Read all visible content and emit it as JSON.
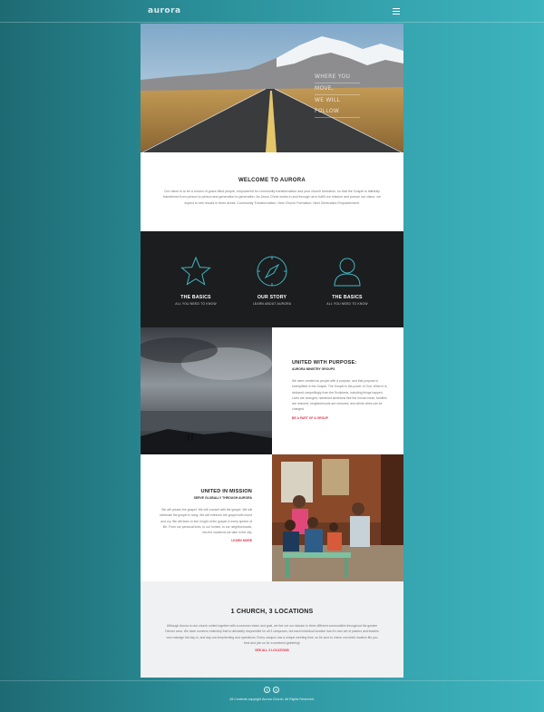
{
  "header": {
    "logo_text": "aurora",
    "menu_icon": "hamburger-icon"
  },
  "hero": {
    "caption_lines": [
      "WHERE YOU",
      "MOVE,",
      "WE WILL FOLLOW"
    ]
  },
  "welcome": {
    "title": "WELCOME TO AURORA",
    "body": "Our vision is to be a church of grace-filled people, empowered for community transformation and your church formation, so that the Gospel is faithfully transferred from person to person and generation to generation. As Jesus Christ works in and through us to fulfill our mission and pursue our vision, we expect to see results in three areas: Community Transformation, New Church Formation, Next Generation Empowerment."
  },
  "features": [
    {
      "icon": "star-icon",
      "title": "THE BASICS",
      "subtitle": "ALL YOU NEED TO KNOW"
    },
    {
      "icon": "compass-icon",
      "title": "OUR STORY",
      "subtitle": "LEARN ABOUT AURORA"
    },
    {
      "icon": "user-icon",
      "title": "THE BASICS",
      "subtitle": "ALL YOU NEED TO KNOW"
    }
  ],
  "purpose": {
    "title": "UNITED WITH PURPOSE:",
    "subtitle": "AURORA MINISTRY GROUPS",
    "body": "We were created as people with a purpose, and that purpose is exemplified in the Gospel. The Gospel is the power of God. When it is declared compellingly from the Scriptures, including things happen. Lives are changed, hardened skeletons flee the human heart, families are restored, neighborhoods are renewed, and whole cities can be changed.",
    "link": "BE A PART OF A GROUP"
  },
  "mission": {
    "title": "UNITED IN MISSION",
    "subtitle": "SERVE GLOBALLY THROUGH AURORA",
    "body": "We will preach the gospel. We will counsel with the gospel. We will celebrate the gospel in song. We will entrench the gospel with found and cry. We will learn to live in light of the gospel in every sphere of life. From our personal lives, to our homes, to our neighborhoods, into the vocations we take in the city.",
    "link": "LEARN MORE"
  },
  "locations": {
    "title": "1 CHURCH, 3 LOCATIONS",
    "body": "Although Aurora is one church united together with a common vision and goal, we live out our mission in three different communities throughout the greater Denver area. We have common eldership that is ultimately responsible for all 3 campuses, but each individual location has it's own set of pastors and leaders who manage the day-in, and day-out shepherding and operations. Every campus has a unique meeting time, so be sure to check out which location fits you best and join us for a weekend gathering!",
    "link": "SEE ALL 3 LOCATIONS"
  },
  "footer": {
    "social": [
      {
        "icon": "facebook-icon",
        "glyph": "f"
      },
      {
        "icon": "twitter-icon",
        "glyph": "t"
      }
    ],
    "copyright": "All Contents copyright Aurora Church. All Rights Reserved."
  },
  "colors": {
    "accent": "#e0344a",
    "icon_stroke": "#3fb6c1",
    "dark_band": "#1c1d1f"
  }
}
